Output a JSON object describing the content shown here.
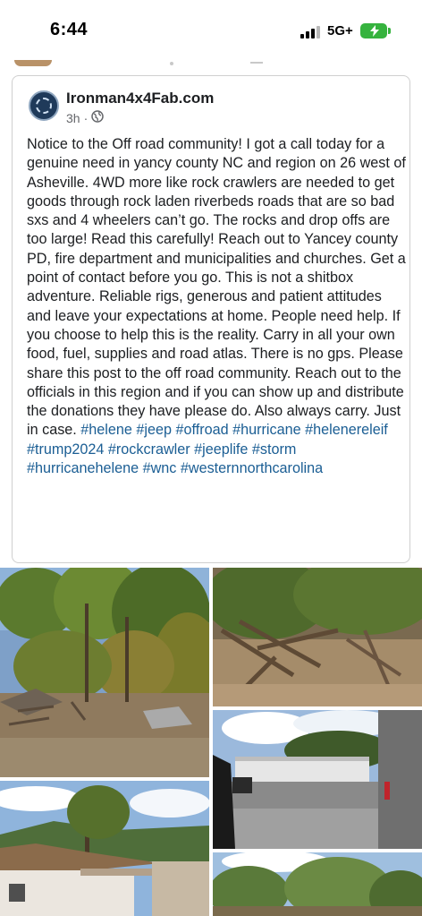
{
  "status_bar": {
    "time": "6:44",
    "network": "5G+",
    "battery_color": "#36b33e",
    "signal_bars_active": 3,
    "signal_bars_total": 4
  },
  "post": {
    "page_name": "Ironman4x4Fab.com",
    "time_ago": "3h",
    "separator": "·",
    "audience_icon": "globe-icon",
    "text": "Notice to the Off road community! I got a call today for a genuine need in yancy county NC and region on 26 west of Asheville. 4WD more like rock crawlers are needed to get goods through rock laden riverbeds roads that are so bad sxs and 4 wheelers can’t go. The rocks and drop offs are too large! Read this carefully! Reach out to Yancey county PD, fire department and municipalities and churches. Get a point of contact before you go. This is not a shitbox adventure. Reliable rigs, generous and patient attitudes and leave your expectations at home. People need help. If you choose to help this is the reality. Carry in all your own food, fuel, supplies and road atlas. There is no gps. Please share this post to the off road community. Reach out to the officials in this region and if you can show up and distribute the donations they have please do. Also always carry. Just in case.",
    "hashtags": "#helene #jeep #offroad #hurricane #helenereleif #trump2024 #rockcrawler #jeeplife #storm #hurricanehelene #wnc #westernnorthcarolina",
    "hashtag_color": "#1b5e94"
  },
  "photos": [
    {
      "name": "photo-flood-debris-woods"
    },
    {
      "name": "photo-uprooted-trees-mud"
    },
    {
      "name": "photo-damaged-building-road"
    },
    {
      "name": "photo-mountain-houses"
    },
    {
      "name": "photo-trees-sky"
    }
  ]
}
